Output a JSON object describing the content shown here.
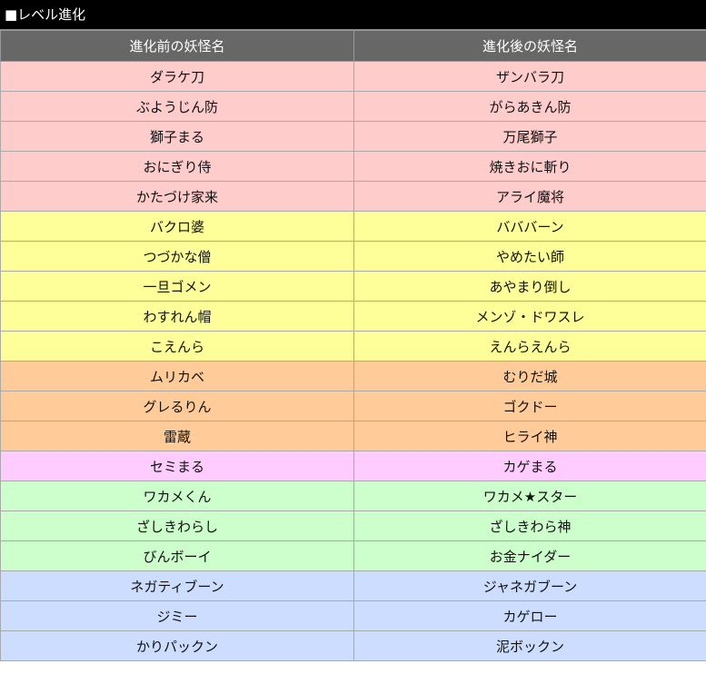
{
  "section": {
    "title": "■レベル進化"
  },
  "table": {
    "headers": [
      "進化前の妖怪名",
      "進化後の妖怪名"
    ],
    "rows": [
      {
        "before": "ダラケ刀",
        "after": "ザンバラ刀",
        "color": "#ffcccc"
      },
      {
        "before": "ぶようじん防",
        "after": "がらあきん防",
        "color": "#ffcccc"
      },
      {
        "before": "獅子まる",
        "after": "万尾獅子",
        "color": "#ffcccc"
      },
      {
        "before": "おにぎり侍",
        "after": "焼きおに斬り",
        "color": "#ffcccc"
      },
      {
        "before": "かたづけ家来",
        "after": "アライ魔将",
        "color": "#ffcccc"
      },
      {
        "before": "バクロ婆",
        "after": "バババーン",
        "color": "#ffff99"
      },
      {
        "before": "つづかな僧",
        "after": "やめたい師",
        "color": "#ffff99"
      },
      {
        "before": "一旦ゴメン",
        "after": "あやまり倒し",
        "color": "#ffff99"
      },
      {
        "before": "わすれん帽",
        "after": "メンゾ・ドワスレ",
        "color": "#ffff99"
      },
      {
        "before": "こえんら",
        "after": "えんらえんら",
        "color": "#ffff99"
      },
      {
        "before": "ムリカベ",
        "after": "むりだ城",
        "color": "#ffcc99"
      },
      {
        "before": "グレるりん",
        "after": "ゴクドー",
        "color": "#ffcc99"
      },
      {
        "before": "雷蔵",
        "after": "ヒライ神",
        "color": "#ffcc99"
      },
      {
        "before": "セミまる",
        "after": "カゲまる",
        "color": "#ffccff"
      },
      {
        "before": "ワカメくん",
        "after": "ワカメ★スター",
        "color": "#ccffcc"
      },
      {
        "before": "ざしきわらし",
        "after": "ざしきわら神",
        "color": "#ccffcc"
      },
      {
        "before": "びんボーイ",
        "after": "お金ナイダー",
        "color": "#ccffcc"
      },
      {
        "before": "ネガティブーン",
        "after": "ジャネガブーン",
        "color": "#ccddff"
      },
      {
        "before": "ジミー",
        "after": "カゲロー",
        "color": "#ccddff"
      },
      {
        "before": "かりパックン",
        "after": "泥ボックン",
        "color": "#ccddff"
      }
    ]
  }
}
